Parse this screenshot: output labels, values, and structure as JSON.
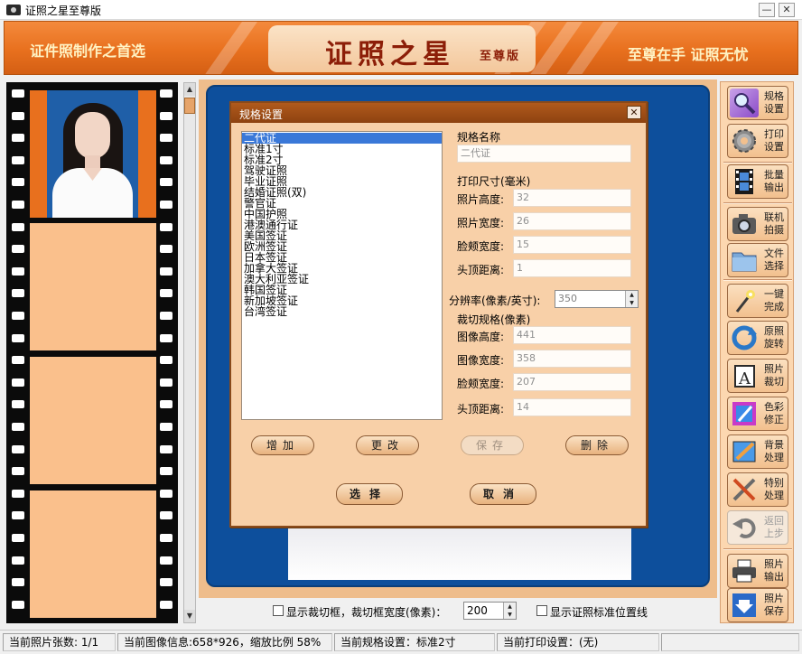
{
  "window": {
    "title": "证照之星至尊版",
    "minimize_glyph": "—",
    "close_glyph": "✕"
  },
  "banner": {
    "slogan_left": "证件照制作之首选",
    "brand_name": "证照之星",
    "brand_edition": "至尊版",
    "slogan_right": "至尊在手 证照无忧"
  },
  "bottom_controls": {
    "show_crop_frame_label": "显示裁切框，裁切框宽度(像素)：",
    "crop_frame_width": "200",
    "show_guide_lines_label": "显示证照标准位置线"
  },
  "toolbar": {
    "spec_settings": "规格设置",
    "print_settings": "打印设置",
    "batch_output": "批量输出",
    "camera_shoot": "联机拍摄",
    "file_select": "文件选择",
    "one_click": "一键完成",
    "rotate": "原照旋转",
    "crop": "照片裁切",
    "color_fix": "色彩修正",
    "background": "背景处理",
    "special": "特别处理",
    "undo": "返回上步",
    "photo_output": "照片输出",
    "photo_save": "照片保存",
    "icons": {
      "spec_settings": "magnifier-icon",
      "print_settings": "gear-icon",
      "batch_output": "film-icon",
      "camera_shoot": "camera-icon",
      "file_select": "folder-icon",
      "one_click": "magic-wand-icon",
      "rotate": "rotate-icon",
      "crop": "crop-icon",
      "color_fix": "color-palette-icon",
      "background": "background-brush-icon",
      "special": "tools-icon",
      "undo": "undo-icon",
      "photo_output": "printer-icon",
      "photo_save": "save-download-icon"
    }
  },
  "dialog": {
    "title": "规格设置",
    "close_glyph": "✕",
    "spec_list": [
      "二代证",
      "标准1寸",
      "标准2寸",
      "驾驶证照",
      "毕业证照",
      "结婚证照(双)",
      "警官证",
      "中国护照",
      "港澳通行证",
      "美国签证",
      "欧洲签证",
      "日本签证",
      "加拿大签证",
      "澳大利亚签证",
      "韩国签证",
      "新加坡签证",
      "台湾签证"
    ],
    "selected_index": 0,
    "name_label": "规格名称",
    "name_value": "二代证",
    "print_size_label": "打印尺寸(毫米)",
    "photo_height_label": "照片高度:",
    "photo_height": "32",
    "photo_width_label": "照片宽度:",
    "photo_width": "26",
    "face_width_label": "脸颊宽度:",
    "face_width": "15",
    "top_distance_label": "头顶距离:",
    "top_distance": "1",
    "resolution_label": "分辨率(像素/英寸):",
    "resolution": "350",
    "crop_spec_label": "裁切规格(像素)",
    "image_height_label": "图像高度:",
    "image_height": "441",
    "image_width_label": "图像宽度:",
    "image_width": "358",
    "crop_face_width_label": "脸颊宽度:",
    "crop_face_width": "207",
    "crop_top_distance_label": "头顶距离:",
    "crop_top_distance": "14",
    "add_button": "增加",
    "edit_button": "更改",
    "save_button": "保存",
    "delete_button": "删除",
    "select_button": "选择",
    "cancel_button": "取消"
  },
  "statusbar": {
    "photo_count": "当前照片张数: 1/1",
    "image_info": "当前图像信息:658*926，缩放比例 58%",
    "spec_setting": "当前规格设置：标准2寸",
    "print_setting": "当前打印设置：(无)"
  },
  "colors": {
    "banner_orange": "#e8701e",
    "brand_red": "#8c1e08",
    "preview_blue": "#0d4f9c",
    "selection_blue": "#3a78d8",
    "dialog_bg": "#f8d0a8"
  }
}
